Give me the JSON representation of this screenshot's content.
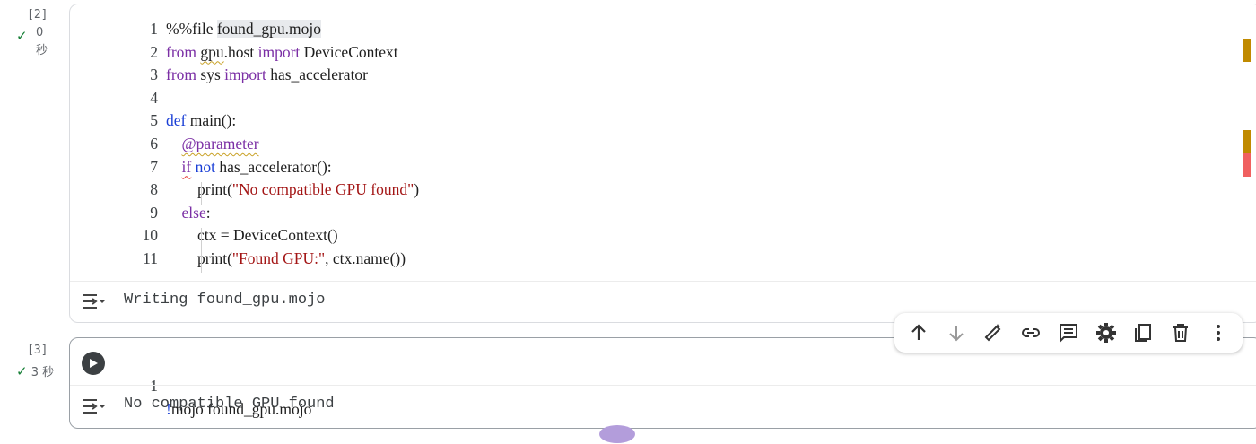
{
  "cells": [
    {
      "exec_count": "[2]",
      "exec_time_num": "0",
      "exec_time_unit": "秒",
      "lines": [
        {
          "n": "1",
          "tokens": [
            {
              "t": "%%file ",
              "c": "plain"
            },
            {
              "t": "found_gpu.mojo",
              "c": "hl"
            }
          ]
        },
        {
          "n": "2",
          "tokens": [
            {
              "t": "from ",
              "c": "kw"
            },
            {
              "t": "gpu",
              "c": "squig-y"
            },
            {
              "t": ".host ",
              "c": "plain"
            },
            {
              "t": "import ",
              "c": "kw"
            },
            {
              "t": "DeviceContext",
              "c": "plain"
            }
          ]
        },
        {
          "n": "3",
          "tokens": [
            {
              "t": "from ",
              "c": "kw"
            },
            {
              "t": "sys ",
              "c": "plain"
            },
            {
              "t": "import ",
              "c": "kw"
            },
            {
              "t": "has_accelerator",
              "c": "plain"
            }
          ]
        },
        {
          "n": "4",
          "tokens": []
        },
        {
          "n": "5",
          "tokens": [
            {
              "t": "def ",
              "c": "kw2"
            },
            {
              "t": "main",
              "c": "plain"
            },
            {
              "t": "():",
              "c": "plain"
            }
          ]
        },
        {
          "n": "6",
          "tokens": [
            {
              "t": "    "
            },
            {
              "t": "@parameter",
              "c": "squig-y-kw"
            }
          ]
        },
        {
          "n": "7",
          "tokens": [
            {
              "t": "    "
            },
            {
              "t": "if",
              "c": "squig-r-kw"
            },
            {
              "t": " "
            },
            {
              "t": "not ",
              "c": "kw2"
            },
            {
              "t": "has_accelerator",
              "c": "plain"
            },
            {
              "t": "():",
              "c": "plain"
            }
          ]
        },
        {
          "n": "8",
          "tokens": [
            {
              "t": "        "
            },
            {
              "t": "print",
              "c": "plain"
            },
            {
              "t": "(",
              "c": "plain"
            },
            {
              "t": "\"No compatible GPU found\"",
              "c": "str"
            },
            {
              "t": ")",
              "c": "plain"
            }
          ]
        },
        {
          "n": "9",
          "tokens": [
            {
              "t": "    "
            },
            {
              "t": "else",
              "c": "kw"
            },
            {
              "t": ":",
              "c": "plain"
            }
          ]
        },
        {
          "n": "10",
          "tokens": [
            {
              "t": "        "
            },
            {
              "t": "ctx = DeviceContext",
              "c": "plain"
            },
            {
              "t": "()",
              "c": "plain"
            }
          ]
        },
        {
          "n": "11",
          "tokens": [
            {
              "t": "        "
            },
            {
              "t": "print",
              "c": "plain"
            },
            {
              "t": "(",
              "c": "plain"
            },
            {
              "t": "\"Found GPU:\"",
              "c": "str"
            },
            {
              "t": ", ctx.name",
              "c": "plain"
            },
            {
              "t": "())",
              "c": "plain"
            }
          ]
        }
      ],
      "output": "Writing found_gpu.mojo"
    },
    {
      "exec_count": "[3]",
      "exec_time": "3 秒",
      "line_num": "1",
      "code_bang": "!",
      "code_rest": "mojo found_gpu.mojo",
      "output": "No compatible GPU found"
    }
  ],
  "toolbar": [
    "arrow-up-icon",
    "arrow-down-icon",
    "magic-pen-icon",
    "link-icon",
    "comment-icon",
    "gear-icon",
    "mirror-cell-icon",
    "trash-icon",
    "more-vert-icon"
  ],
  "colors": {
    "keyword": "#7b2fa5",
    "keyword2": "#1a3fd6",
    "string": "#a31515",
    "success": "#188038",
    "warn_mark": "#c08a00",
    "error_mark": "#f06060"
  }
}
